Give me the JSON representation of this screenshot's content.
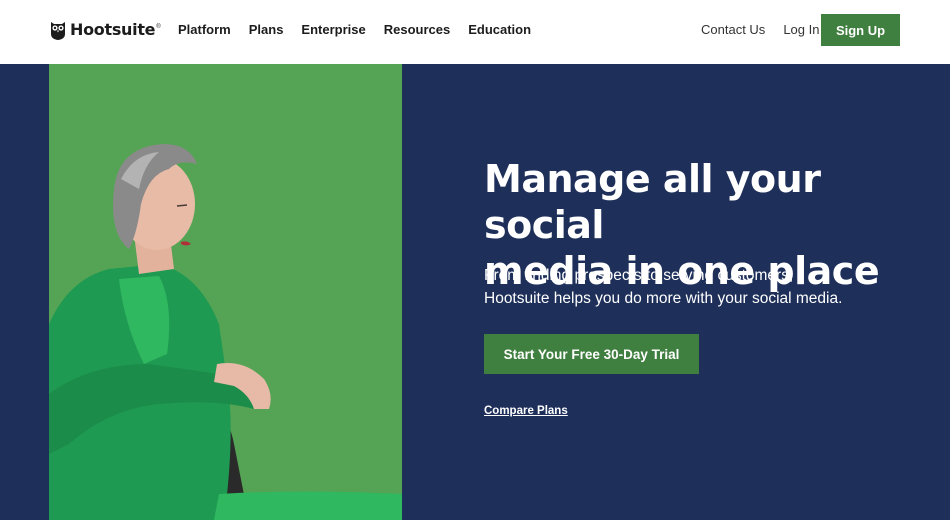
{
  "nav": {
    "brand": "Hootsuite",
    "brand_tm": "®",
    "items": [
      "Platform",
      "Plans",
      "Enterprise",
      "Resources",
      "Education"
    ],
    "contact_label": "Contact Us",
    "login_label": "Log In",
    "signup_label": "Sign Up"
  },
  "hero": {
    "headline_line1": "Manage all your social",
    "headline_line2": "media in one place",
    "subtext_line1": "From finding prospects to serving customers,",
    "subtext_line2": "Hootsuite helps you do more with your social media.",
    "cta_label": "Start Your Free 30-Day Trial",
    "compare_label": "Compare Plans"
  },
  "colors": {
    "hero_bg": "#1e2f5a",
    "brand_green": "#3f7f3f",
    "photo_bg": "#53a253"
  },
  "icons": {
    "logo": "owl-logo-icon"
  }
}
